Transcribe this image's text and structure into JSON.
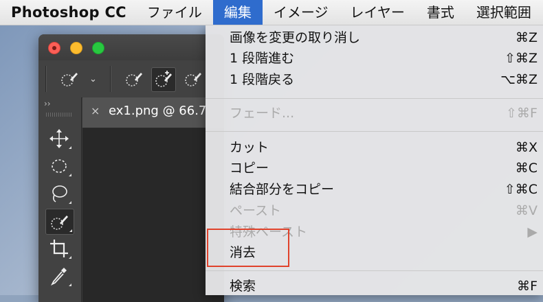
{
  "menubar": {
    "app_name": "Photoshop CC",
    "menus": [
      "ファイル",
      "編集",
      "イメージ",
      "レイヤー",
      "書式",
      "選択範囲"
    ],
    "active_menu": "編集"
  },
  "window": {
    "document_tab": "ex1.png @ 66.7",
    "collapse_glyph": "››"
  },
  "edit_menu": {
    "items": [
      {
        "label": "画像を変更の取り消し",
        "shortcut": "⌘Z",
        "enabled": true
      },
      {
        "label": "1 段階進む",
        "shortcut": "⇧⌘Z",
        "enabled": true
      },
      {
        "label": "1 段階戻る",
        "shortcut": "⌥⌘Z",
        "enabled": true
      },
      {
        "label": "フェード...",
        "shortcut": "⇧⌘F",
        "enabled": false
      },
      {
        "label": "カット",
        "shortcut": "⌘X",
        "enabled": true
      },
      {
        "label": "コピー",
        "shortcut": "⌘C",
        "enabled": true
      },
      {
        "label": "結合部分をコピー",
        "shortcut": "⇧⌘C",
        "enabled": true
      },
      {
        "label": "ペースト",
        "shortcut": "⌘V",
        "enabled": false
      },
      {
        "label": "特殊ペースト",
        "shortcut": "▶",
        "enabled": false
      },
      {
        "label": "消去",
        "shortcut": "",
        "enabled": true
      },
      {
        "label": "検索",
        "shortcut": "⌘F",
        "enabled": true
      }
    ]
  },
  "icons": {
    "tools": [
      "move-icon",
      "marquee-icon",
      "lasso-icon",
      "quick-selection-icon",
      "crop-icon",
      "eyedropper-icon"
    ]
  },
  "colors": {
    "menu_active": "#2f6ccd",
    "highlight": "#e0412a"
  }
}
